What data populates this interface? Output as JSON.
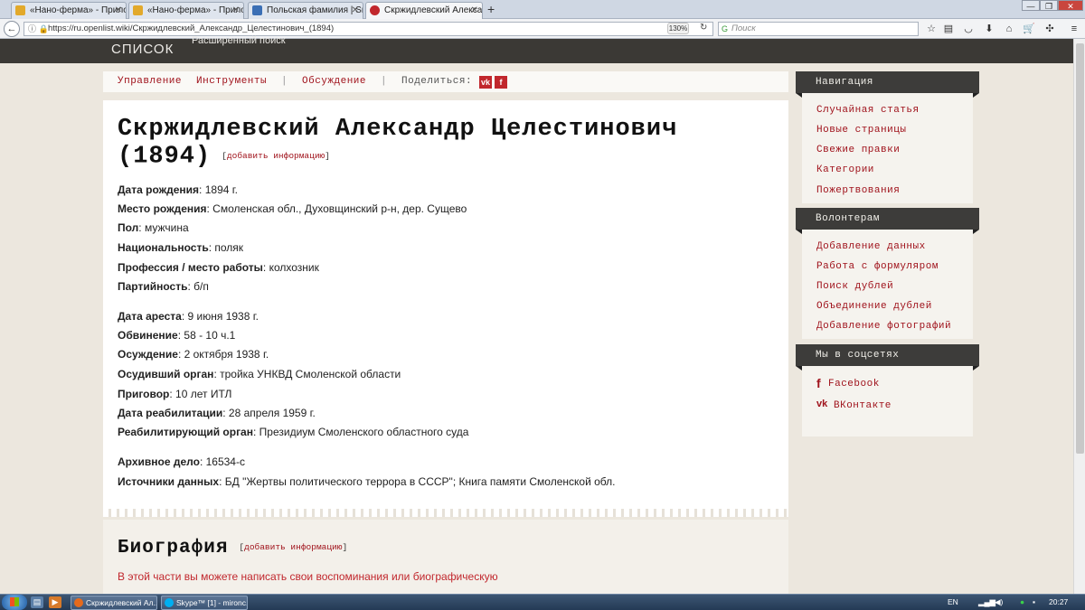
{
  "browser": {
    "tabs": [
      {
        "label": "«Нано-ферма» - Приложен...",
        "favicon_color": "#e2a92b"
      },
      {
        "label": "«Нано-ферма» - Приложен...",
        "favicon_color": "#e2a92b"
      },
      {
        "label": "Польская фамилия | SmolB...",
        "favicon_color": "#3b6fb5"
      },
      {
        "label": "Скржидлевский Александ...",
        "favicon_color": "#c1272d"
      }
    ],
    "new_tab": "+",
    "window_controls": {
      "minimize": "—",
      "maximize": "❐",
      "close": "✕"
    },
    "url": "https://ru.openlist.wiki/Скржидлевский_Александр_Целестинович_(1894)",
    "zoom": "130%",
    "search_placeholder": "Поиск"
  },
  "site": {
    "logo": "СПИСОК",
    "advanced_search": "Расширенный поиск"
  },
  "toolbar": {
    "manage": "Управление",
    "tools": "Инструменты",
    "sep1": "|",
    "discussion": "Обсуждение",
    "sep2": "|",
    "share_label": "Поделиться:",
    "vk_icon": "vk",
    "fb_icon": "f"
  },
  "person": {
    "title": "Скржидлевский Александр Целестинович (1894)",
    "add_info_open": "[",
    "add_info": "добавить информацию",
    "add_info_close": "]",
    "fields": [
      {
        "label": "Дата рождения",
        "value": ": 1894 г."
      },
      {
        "label": "Место рождения",
        "value": ": Смоленская обл., Духовщинский р-н, дер. Сущево"
      },
      {
        "label": "Пол",
        "value": ": мужчина"
      },
      {
        "label": "Национальность",
        "value": ": поляк"
      },
      {
        "label": "Профессия / место работы",
        "value": ": колхозник"
      },
      {
        "label": "Партийность",
        "value": ": б/п"
      },
      {
        "label": "Дата ареста",
        "value": ": 9 июня 1938 г."
      },
      {
        "label": "Обвинение",
        "value": ": 58 - 10 ч.1"
      },
      {
        "label": "Осуждение",
        "value": ": 2 октября 1938 г."
      },
      {
        "label": "Осудивший орган",
        "value": ": тройка УНКВД Смоленской области"
      },
      {
        "label": "Приговор",
        "value": ": 10 лет ИТЛ"
      },
      {
        "label": "Дата реабилитации",
        "value": ": 28 апреля 1959 г."
      },
      {
        "label": "Реабилитирующий орган",
        "value": ": Президиум Смоленского областного суда"
      },
      {
        "label": "Архивное дело",
        "value": ": 16534-с"
      },
      {
        "label": "Источники данных",
        "value": ": БД \"Жертвы политического террора в СССР\"; Книга памяти Смоленской обл."
      }
    ]
  },
  "biography": {
    "title": "Биография",
    "add_info": "добавить информацию",
    "text": "В этой части вы можете написать свои воспоминания или биографическую"
  },
  "sidebar": {
    "navigation": {
      "title": "Навигация",
      "links": [
        "Случайная статья",
        "Новые страницы",
        "Свежие правки",
        "Категории",
        "Пожертвования"
      ]
    },
    "volunteers": {
      "title": "Волонтерам",
      "links": [
        "Добавление данных",
        "Работа с формуляром",
        "Поиск дублей",
        "Объединение дублей",
        "Добавление фотографий"
      ]
    },
    "social": {
      "title": "Мы в соцсетях",
      "links": [
        {
          "icon": "f",
          "label": "Facebook"
        },
        {
          "icon": "vk",
          "label": "ВКонтакте"
        }
      ]
    }
  },
  "taskbar": {
    "tasks": [
      {
        "label": "Скржидлевский Ал...",
        "icon_color": "#e66a1c"
      },
      {
        "label": "Skype™ [1] - mironc...",
        "icon_color": "#00aff0"
      }
    ],
    "lang": "EN",
    "clock": "20:27"
  }
}
